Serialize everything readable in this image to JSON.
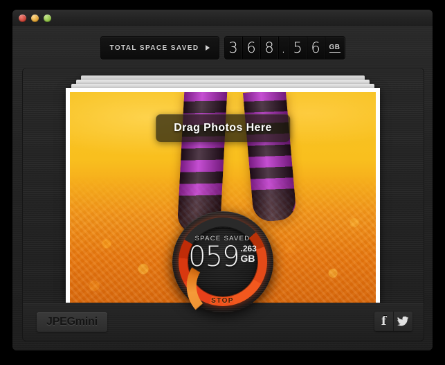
{
  "window": {
    "traffic_lights": [
      {
        "name": "close",
        "color": "#c43b2e"
      },
      {
        "name": "minimize",
        "color": "#d99a2a"
      },
      {
        "name": "zoom",
        "color": "#85b93c"
      }
    ]
  },
  "toolbar": {
    "total_label": "TOTAL SPACE SAVED",
    "expand_icon": "triangle-right-icon",
    "total_value": "368.56",
    "total_digits": [
      "3",
      "6",
      "8",
      ".",
      "5",
      "6"
    ],
    "total_unit": "GB"
  },
  "stage": {
    "drop_label": "Drag Photos Here",
    "photo_description": "legs wearing purple and black striped socks standing on orange autumn leaves"
  },
  "gauge": {
    "title": "SPACE SAVED",
    "whole": "059",
    "decimal": ".263",
    "unit": "GB",
    "stop_label": "STOP",
    "ring_color": "#e8401a",
    "stop_color": "#ef9433"
  },
  "footer": {
    "logo": "JPEGmini",
    "social": [
      {
        "name": "facebook-icon",
        "glyph": "f"
      },
      {
        "name": "twitter-icon",
        "glyph": "bird"
      }
    ]
  }
}
